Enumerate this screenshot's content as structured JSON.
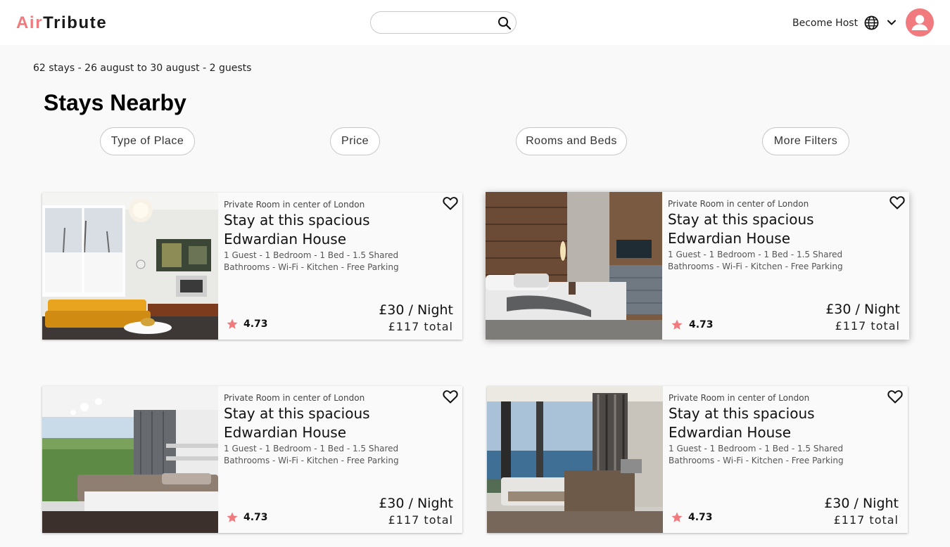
{
  "header": {
    "logo_part1": "Air",
    "logo_part2": "Tribute",
    "search_value": "",
    "search_placeholder": "",
    "search_icon": "search-icon",
    "host_label": "Become Host",
    "globe_icon": "globe-icon",
    "chevron_icon": "chevron-down-icon",
    "avatar_icon": "user-avatar-icon"
  },
  "summary": "62 stays - 26 august to 30 august - 2 guests",
  "page_title": "Stays Nearby",
  "filters": [
    "Type of Place",
    "Price",
    "Rooms and Beds",
    "More Filters"
  ],
  "colors": {
    "accent": "#f07a7e",
    "background": "#f9f9f9"
  },
  "listings": [
    {
      "subtitle": "Private Room in center of London",
      "title": "Stay at this spacious Edwardian House",
      "amenities": "1 Guest - 1 Bedroom - 1 Bed - 1.5 Shared Bathrooms - Wi-Fi - Kitchen - Free Parking",
      "rating": "4.73",
      "price": "£30 / Night",
      "total": "£117 total",
      "image": "living room with yellow sofa"
    },
    {
      "subtitle": "Private Room in center of London",
      "title": "Stay at this spacious Edwardian House",
      "amenities": "1 Guest - 1 Bedroom - 1 Bed - 1.5 Shared Bathrooms - Wi-Fi - Kitchen - Free Parking",
      "rating": "4.73",
      "price": "£30 / Night",
      "total": "£117 total",
      "image": "bedroom with wood panel wall"
    },
    {
      "subtitle": "Private Room in center of London",
      "title": "Stay at this spacious Edwardian House",
      "amenities": "1 Guest - 1 Bedroom - 1 Bed - 1.5 Shared Bathrooms - Wi-Fi - Kitchen - Free Parking",
      "rating": "4.73",
      "price": "£30 / Night",
      "total": "£117 total",
      "image": "bright bedroom with grey curtains"
    },
    {
      "subtitle": "Private Room in center of London",
      "title": "Stay at this spacious Edwardian House",
      "amenities": "1 Guest - 1 Bedroom - 1 Bed - 1.5 Shared Bathrooms - Wi-Fi - Kitchen - Free Parking",
      "rating": "4.73",
      "price": "£30 / Night",
      "total": "£117 total",
      "image": "bedroom with sea view"
    }
  ]
}
